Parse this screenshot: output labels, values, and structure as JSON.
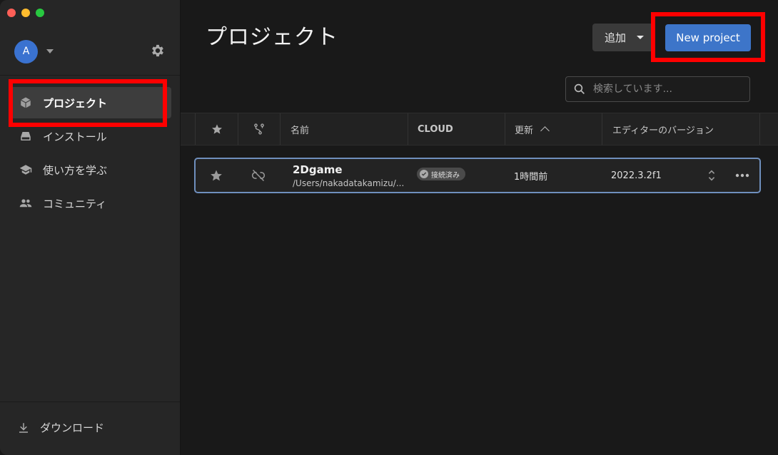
{
  "window": {
    "traffic_lights": {
      "close": "#fe5f57",
      "minimize": "#febc2e",
      "zoom": "#28c840"
    }
  },
  "sidebar": {
    "avatar_initial": "A",
    "items": [
      {
        "label": "プロジェクト",
        "icon": "cube-icon",
        "active": true
      },
      {
        "label": "インストール",
        "icon": "drive-icon",
        "active": false
      },
      {
        "label": "使い方を学ぶ",
        "icon": "graduation-cap-icon",
        "active": false
      },
      {
        "label": "コミュニティ",
        "icon": "people-icon",
        "active": false
      }
    ],
    "download_label": "ダウンロード"
  },
  "header": {
    "title": "プロジェクト",
    "add_label": "追加",
    "new_project_label": "New project"
  },
  "search": {
    "placeholder": "検索しています..."
  },
  "table": {
    "columns": {
      "name": "名前",
      "cloud": "CLOUD",
      "updated": "更新",
      "editor_version": "エディターのバージョン"
    },
    "rows": [
      {
        "name": "2Dgame",
        "path": "/Users/nakadatakamizu/...",
        "cloud_status": "接続済み",
        "updated": "1時間前",
        "editor_version": "2022.3.2f1"
      }
    ]
  },
  "colors": {
    "accent": "#3d75c9",
    "annotation": "#ff0000",
    "selected_row_border": "#6f8fbd"
  }
}
